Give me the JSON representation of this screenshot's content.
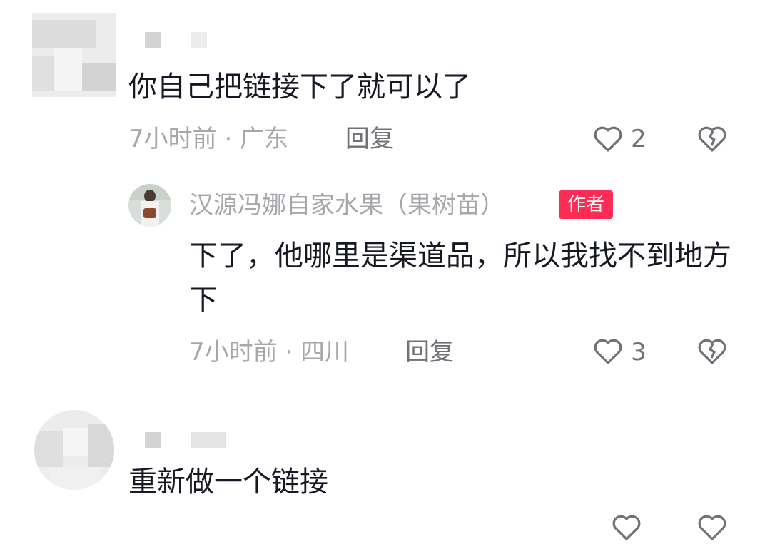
{
  "comments": [
    {
      "text": "你自己把链接下了就可以了",
      "meta": "7小时前 · 广东",
      "reply_label": "回复",
      "likes": "2",
      "replies": [
        {
          "username": "汉源冯娜自家水果（果树苗）",
          "badge": "作者",
          "text": "下了，他哪里是渠道品，所以我找不到地方下",
          "meta": "7小时前 · 四川",
          "reply_label": "回复",
          "likes": "3"
        }
      ]
    },
    {
      "text": "重新做一个链接",
      "meta": "",
      "reply_label": "",
      "likes": ""
    }
  ],
  "icons": {
    "like": "heart-outline-icon",
    "dislike": "broken-heart-icon"
  },
  "colors": {
    "text_primary": "#161823",
    "text_secondary": "#a6a7ab",
    "author_badge": "#fe2c55"
  }
}
